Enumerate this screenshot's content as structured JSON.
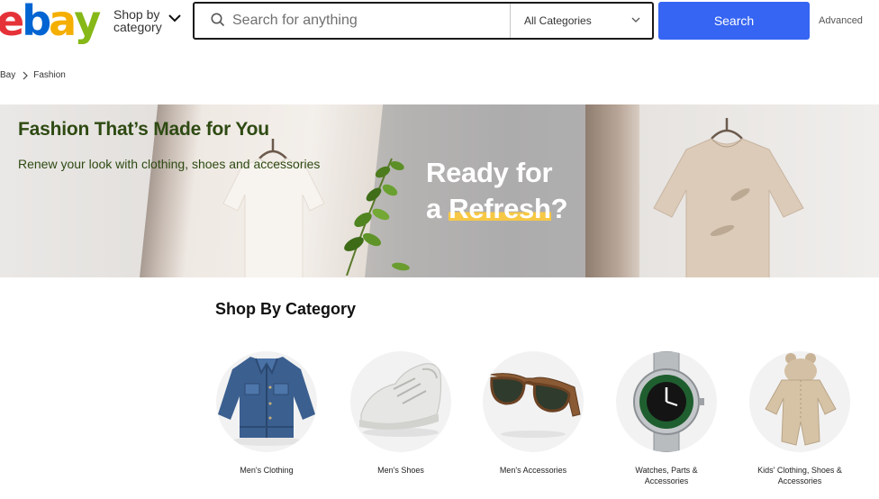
{
  "header": {
    "logo": {
      "letters": [
        "e",
        "b",
        "a",
        "y"
      ],
      "colors": [
        "#e53238",
        "#0064d2",
        "#f5af02",
        "#86b817"
      ]
    },
    "shop_by_line1": "Shop by",
    "shop_by_line2": "category",
    "search_placeholder": "Search for anything",
    "category_select": "All Categories",
    "search_button": "Search",
    "advanced_link": "Advanced"
  },
  "breadcrumb": {
    "home": "Bay",
    "current": "Fashion"
  },
  "banner": {
    "title": "Fashion That’s Made for You",
    "subtitle": "Renew your look with clothing, shoes and accessories",
    "promo_line1": "Ready for",
    "promo_line2_a": "a ",
    "promo_line2_highlight": "Refresh",
    "promo_line2_b": "?"
  },
  "categories": {
    "heading": "Shop By Category",
    "items": [
      {
        "label": "Men's Clothing",
        "icon": "denim-jacket-icon"
      },
      {
        "label": "Men's Shoes",
        "icon": "sneaker-icon"
      },
      {
        "label": "Men's Accessories",
        "icon": "sunglasses-icon"
      },
      {
        "label_line1": "Watches, Parts &",
        "label_line2": "Accessories",
        "icon": "watch-icon"
      },
      {
        "label_line1": "Kids' Clothing, Shoes &",
        "label_line2": "Accessories",
        "icon": "baby-romper-icon"
      }
    ]
  },
  "colors": {
    "accent": "#3665f3",
    "banner_text": "#2e4a12",
    "highlight": "#f7c845"
  }
}
